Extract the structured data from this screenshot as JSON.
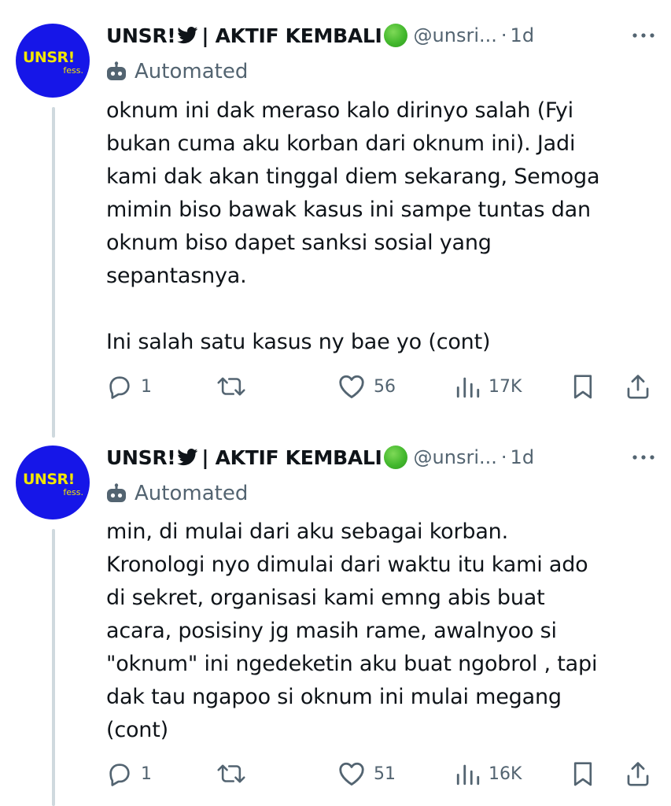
{
  "tweets": [
    {
      "author": {
        "avatar_text": "UNSR!",
        "avatar_subtext": "fess.",
        "name_part1": "UNSR!",
        "name_part2": " | AKTIF KEMBALI",
        "handle": "@unsri...",
        "separator": "·",
        "time": "1d"
      },
      "automated_label": "Automated",
      "text": "oknum ini dak meraso kalo dirinyo salah (Fyi\nbukan cuma aku korban dari oknum ini). Jadi\nkami dak akan tinggal diem sekarang, Semoga\nmimin biso bawak kasus ini sampe tuntas dan\noknum biso dapet sanksi sosial yang\nsepantasnya.\n\nIni salah satu kasus ny bae yo (cont)",
      "stats": {
        "replies": "1",
        "retweets": "",
        "likes": "56",
        "views": "17K"
      }
    },
    {
      "author": {
        "avatar_text": "UNSR!",
        "avatar_subtext": "fess.",
        "name_part1": "UNSR!",
        "name_part2": " | AKTIF KEMBALI",
        "handle": "@unsri...",
        "separator": "·",
        "time": "1d"
      },
      "automated_label": "Automated",
      "text": "min, di mulai dari aku sebagai korban.\nKronologi nyo dimulai dari waktu itu kami ado\ndi sekret, organisasi kami emng abis buat\nacara, posisiny jg masih rame, awalnyoo si\n\"oknum\" ini ngedeketin aku buat ngobrol , tapi\ndak tau ngapoo si oknum ini mulai megang\n(cont)",
      "stats": {
        "replies": "1",
        "retweets": "",
        "likes": "51",
        "views": "16K"
      }
    }
  ],
  "colors": {
    "avatar_bg": "#1616e8",
    "avatar_text": "#f2e600",
    "text_primary": "#0f1419",
    "text_secondary": "#536471",
    "thread_line": "#cfd9de",
    "verified_dot": "#43b82d"
  },
  "icons": {
    "brand": "bird-icon",
    "status": "green-circle",
    "automated": "robot-icon",
    "more": "more-icon",
    "reply": "reply-icon",
    "retweet": "retweet-icon",
    "like": "heart-icon",
    "views": "views-icon",
    "bookmark": "bookmark-icon",
    "share": "share-icon"
  }
}
